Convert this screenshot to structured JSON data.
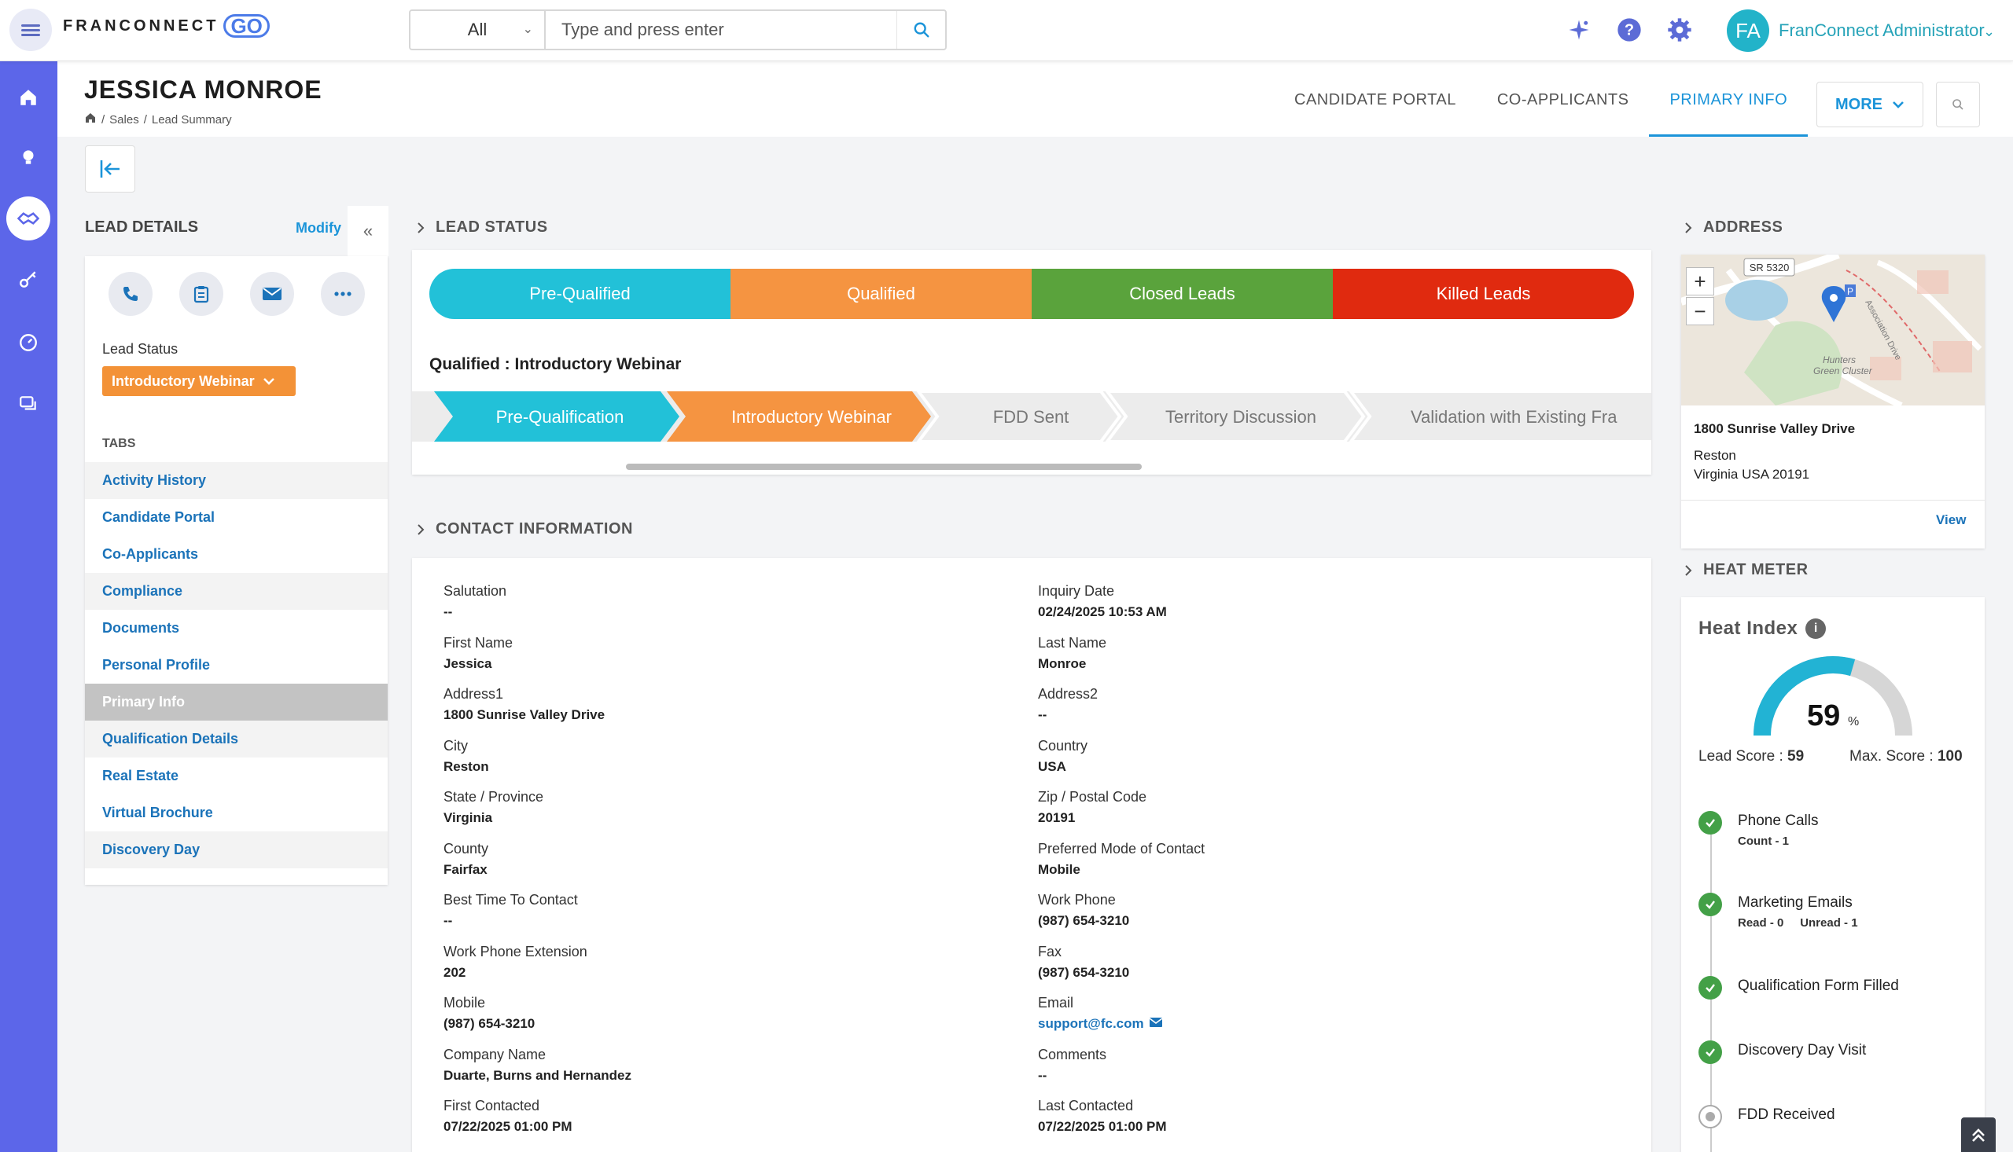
{
  "topbar": {
    "logo_text": "FRANCONNECT",
    "logo_go": "GO",
    "search_scope": "All",
    "search_placeholder": "Type and press enter",
    "user_initials": "FA",
    "user_name": "FranConnect Administrator"
  },
  "icons": {
    "menu": "hamburger-icon",
    "search": "search-icon",
    "sparkle": "sparkle-icon",
    "help": "help-icon",
    "settings": "gear-icon"
  },
  "leftnav": [
    "home-icon",
    "lightbulb-icon",
    "handshake-icon",
    "key-icon",
    "dashboard-icon",
    "chat-icon"
  ],
  "header": {
    "title": "JESSICA MONROE",
    "breadcrumb": [
      "Sales",
      "Lead Summary"
    ],
    "tabs": [
      "CANDIDATE PORTAL",
      "CO-APPLICANTS",
      "PRIMARY INFO"
    ],
    "active_tab": "PRIMARY INFO",
    "more_label": "MORE"
  },
  "lead_details": {
    "heading": "LEAD DETAILS",
    "modify_label": "Modify",
    "status_label": "Lead Status",
    "status_value": "Introductory Webinar",
    "tabs_heading": "TABS",
    "tabs": [
      "Activity History",
      "Candidate Portal",
      "Co-Applicants",
      "Compliance",
      "Documents",
      "Personal Profile",
      "Primary Info",
      "Qualification Details",
      "Real Estate",
      "Virtual Brochure",
      "Discovery Day"
    ],
    "selected_tab": "Primary Info"
  },
  "lead_status": {
    "heading": "LEAD STATUS",
    "stages": [
      {
        "label": "Pre-Qualified",
        "color": "#22c1d8"
      },
      {
        "label": "Qualified",
        "color": "#f59441"
      },
      {
        "label": "Closed Leads",
        "color": "#5aa33c"
      },
      {
        "label": "Killed Leads",
        "color": "#e02a0f"
      }
    ],
    "current": "Qualified : Introductory Webinar",
    "steps": [
      {
        "label": "Pre-Qualification",
        "state": "done"
      },
      {
        "label": "Introductory Webinar",
        "state": "current"
      },
      {
        "label": "FDD Sent",
        "state": "todo"
      },
      {
        "label": "Territory Discussion",
        "state": "todo"
      },
      {
        "label": "Validation with Existing Fra",
        "state": "todo"
      }
    ]
  },
  "contact": {
    "heading": "CONTACT INFORMATION",
    "left": [
      {
        "label": "Salutation",
        "value": "--"
      },
      {
        "label": "First Name",
        "value": "Jessica"
      },
      {
        "label": "Address1",
        "value": "1800 Sunrise Valley Drive"
      },
      {
        "label": "City",
        "value": "Reston"
      },
      {
        "label": "State / Province",
        "value": "Virginia"
      },
      {
        "label": "County",
        "value": "Fairfax"
      },
      {
        "label": "Best Time To Contact",
        "value": "--"
      },
      {
        "label": "Work Phone Extension",
        "value": "202"
      },
      {
        "label": "Mobile",
        "value": "(987) 654-3210"
      },
      {
        "label": "Company Name",
        "value": "Duarte, Burns and Hernandez"
      },
      {
        "label": "First Contacted",
        "value": "07/22/2025 01:00 PM"
      }
    ],
    "right": [
      {
        "label": "Inquiry Date",
        "value": "02/24/2025 10:53 AM"
      },
      {
        "label": "Last Name",
        "value": "Monroe"
      },
      {
        "label": "Address2",
        "value": "--"
      },
      {
        "label": "Country",
        "value": "USA"
      },
      {
        "label": "Zip / Postal Code",
        "value": "20191"
      },
      {
        "label": "Preferred Mode of Contact",
        "value": "Mobile"
      },
      {
        "label": "Work Phone",
        "value": "(987) 654-3210"
      },
      {
        "label": "Fax",
        "value": "(987) 654-3210"
      },
      {
        "label": "Email",
        "value": "support@fc.com"
      },
      {
        "label": "Comments",
        "value": "--"
      },
      {
        "label": "Last Contacted",
        "value": "07/22/2025 01:00 PM"
      }
    ]
  },
  "address": {
    "heading": "ADDRESS",
    "map_label_road": "SR 5320",
    "map_label_1": "Hunters",
    "map_label_2": "Green Cluster",
    "map_label_3": "Association Drive",
    "map_label_4": "P",
    "zoom_in": "+",
    "zoom_out": "−",
    "line1": "1800 Sunrise Valley Drive",
    "line2": "Reston",
    "line3": "Virginia USA 20191",
    "view_label": "View"
  },
  "heat_meter": {
    "heading": "HEAT METER",
    "title": "Heat Index",
    "info": "i",
    "value": 59,
    "value_text": "59",
    "pct": "%",
    "lead_score_label": "Lead Score :",
    "lead_score": "59",
    "max_score_label": "Max. Score :",
    "max_score": "100",
    "max_value": 100,
    "items": [
      {
        "title": "Phone Calls",
        "sub": "Count - 1",
        "done": true
      },
      {
        "title": "Marketing Emails",
        "sub": "Read - 0     Unread - 1",
        "done": true
      },
      {
        "title": "Qualification Form Filled",
        "sub": "",
        "done": true
      },
      {
        "title": "Discovery Day Visit",
        "sub": "",
        "done": true
      },
      {
        "title": "FDD Received",
        "sub": "",
        "done": false
      }
    ]
  }
}
